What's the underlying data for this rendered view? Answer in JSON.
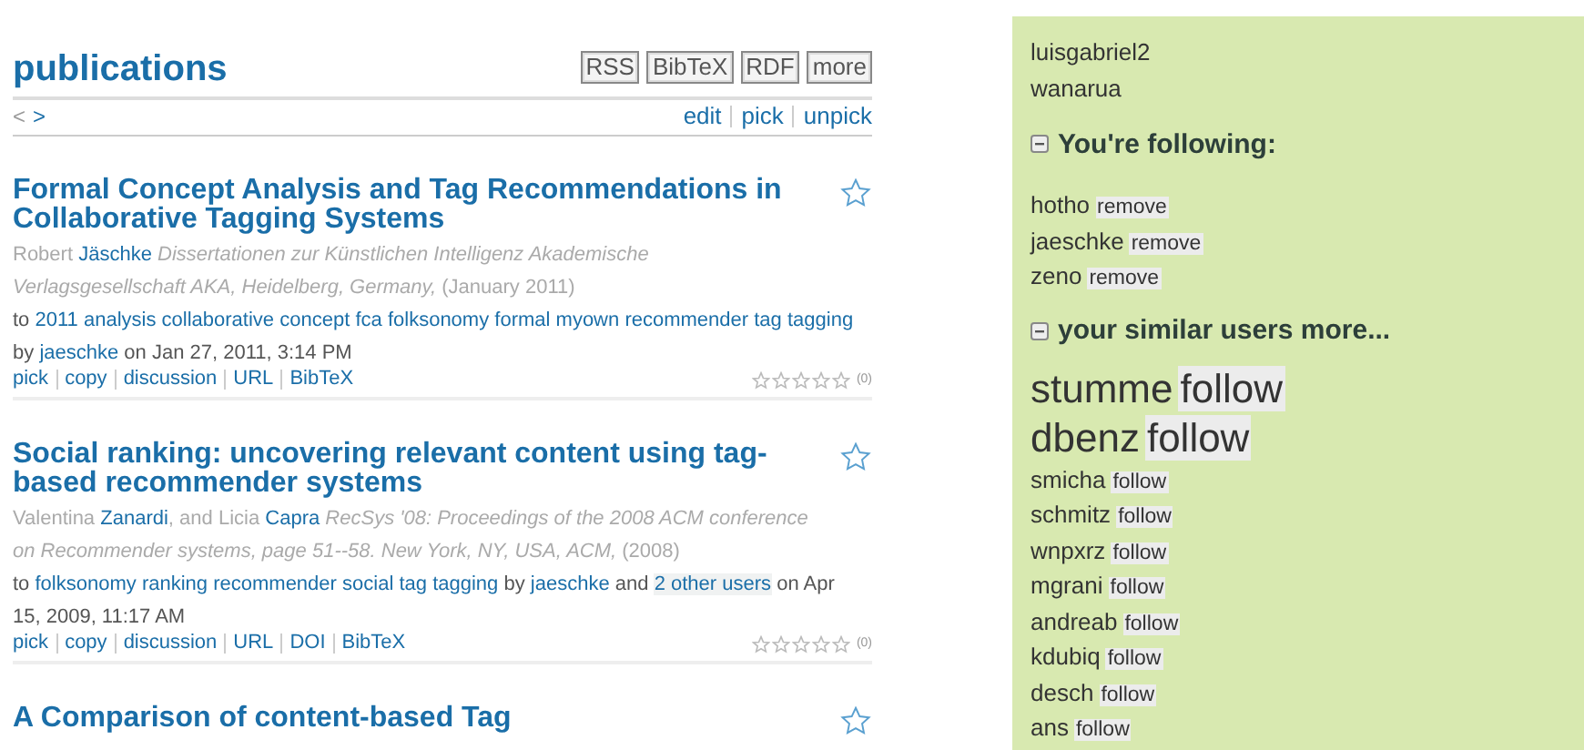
{
  "main": {
    "title": "publications",
    "formats": [
      "RSS",
      "BibTeX",
      "RDF",
      "more"
    ],
    "pager": [
      "<",
      ">"
    ],
    "list_actions": [
      "edit",
      "pick",
      "unpick"
    ],
    "posts": [
      {
        "title": "Formal Concept Analysis and Tag Recommendations in Collaborative Tagging Systems",
        "authors": [
          {
            "first": "Robert",
            "last": "Jäschke"
          }
        ],
        "venue": "Dissertationen zur Künstlichen Intelligenz Akademische Verlagsgesellschaft AKA, Heidelberg, Germany,",
        "year": "(January 2011)",
        "tagline": [
          {
            "kind": "plain",
            "text": "to"
          },
          {
            "kind": "link",
            "text": "2011"
          },
          {
            "kind": "link",
            "text": "analysis"
          },
          {
            "kind": "link",
            "text": "collaborative"
          },
          {
            "kind": "link",
            "text": "concept"
          },
          {
            "kind": "link",
            "text": "fca"
          },
          {
            "kind": "link",
            "text": "folksonomy"
          },
          {
            "kind": "link",
            "text": "formal"
          },
          {
            "kind": "link",
            "text": "myown"
          },
          {
            "kind": "link",
            "text": "recommender"
          },
          {
            "kind": "link",
            "text": "tag"
          },
          {
            "kind": "link",
            "text": "tagging"
          },
          {
            "kind": "plain",
            "text": "by"
          },
          {
            "kind": "link",
            "text": "jaeschke"
          },
          {
            "kind": "plain",
            "text": "on Jan 27, 2011, 3:14 PM"
          }
        ],
        "actions": [
          "pick",
          "copy",
          "discussion",
          "URL",
          "BibTeX"
        ],
        "stars": 0,
        "votes": "(0)"
      },
      {
        "title": "Social ranking: uncovering relevant content using tag-based recommender systems",
        "authors": [
          {
            "first": "Valentina",
            "last": "Zanardi",
            "after": ", and"
          },
          {
            "first": "Licia",
            "last": "Capra"
          }
        ],
        "venue": "RecSys '08: Proceedings of the 2008 ACM conference on Recommender systems, page 51--58. New York, NY, USA, ACM,",
        "year": "(2008)",
        "tagline": [
          {
            "kind": "plain",
            "text": "to"
          },
          {
            "kind": "link",
            "text": "folksonomy"
          },
          {
            "kind": "link",
            "text": "ranking"
          },
          {
            "kind": "link",
            "text": "recommender"
          },
          {
            "kind": "link",
            "text": "social"
          },
          {
            "kind": "link",
            "text": "tag"
          },
          {
            "kind": "link",
            "text": "tagging"
          },
          {
            "kind": "plain",
            "text": "by"
          },
          {
            "kind": "link",
            "text": "jaeschke"
          },
          {
            "kind": "plain",
            "text": "and"
          },
          {
            "kind": "boxed",
            "text": "2 other users"
          },
          {
            "kind": "plain",
            "text": "on Apr 15, 2009, 11:17 AM"
          }
        ],
        "actions": [
          "pick",
          "copy",
          "discussion",
          "URL",
          "DOI",
          "BibTeX"
        ],
        "stars": 0,
        "votes": "(0)"
      },
      {
        "title": "A Comparison of content-based Tag"
      }
    ]
  },
  "sidebar": {
    "users": [
      "luisgabriel2",
      "wanarua"
    ],
    "following": {
      "heading": "You're following:",
      "items": [
        {
          "name": "hotho",
          "action": "remove"
        },
        {
          "name": "jaeschke",
          "action": "remove"
        },
        {
          "name": "zeno",
          "action": "remove"
        }
      ]
    },
    "similar": {
      "heading": "your similar users more...",
      "items": [
        {
          "name": "stumme",
          "action": "follow",
          "kind": "large"
        },
        {
          "name": "dbenz",
          "action": "follow",
          "kind": "large"
        },
        {
          "name": "smicha",
          "action": "follow",
          "kind": "normal"
        },
        {
          "name": "schmitz",
          "action": "follow",
          "kind": "normal"
        },
        {
          "name": "wnpxrz",
          "action": "follow",
          "kind": "normal"
        },
        {
          "name": "mgrani",
          "action": "follow",
          "kind": "normal"
        },
        {
          "name": "andreab",
          "action": "follow",
          "kind": "normal"
        },
        {
          "name": "kdubiq",
          "action": "follow",
          "kind": "normal"
        },
        {
          "name": "desch",
          "action": "follow",
          "kind": "normal"
        },
        {
          "name": "ans",
          "action": "follow",
          "kind": "normal"
        }
      ]
    }
  }
}
